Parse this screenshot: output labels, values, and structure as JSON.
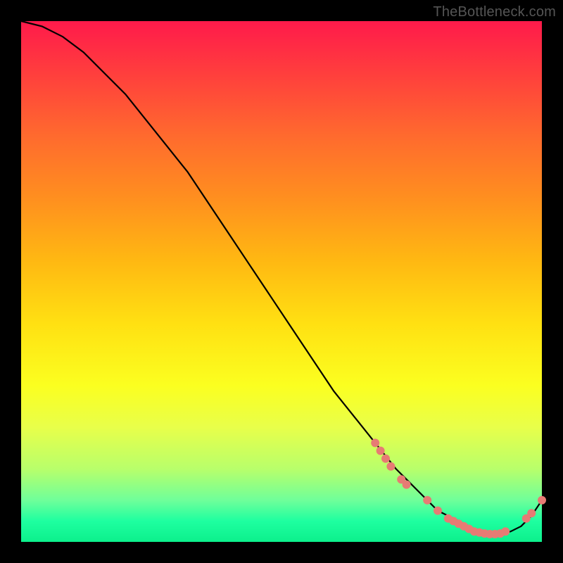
{
  "watermark": "TheBottleneck.com",
  "chart_data": {
    "type": "line",
    "title": "",
    "xlabel": "",
    "ylabel": "",
    "xlim": [
      0,
      100
    ],
    "ylim": [
      0,
      100
    ],
    "grid": false,
    "legend": false,
    "series": [
      {
        "name": "curve",
        "color": "#000000",
        "x": [
          0,
          4,
          8,
          12,
          16,
          20,
          24,
          28,
          32,
          36,
          40,
          44,
          48,
          52,
          56,
          60,
          64,
          68,
          72,
          74,
          76,
          78,
          80,
          82,
          84,
          86,
          88,
          90,
          92,
          94,
          96,
          98,
          100
        ],
        "y": [
          100,
          99,
          97,
          94,
          90,
          86,
          81,
          76,
          71,
          65,
          59,
          53,
          47,
          41,
          35,
          29,
          24,
          19,
          14,
          12,
          10,
          8,
          6,
          5,
          4,
          3,
          2,
          1.5,
          1.5,
          2,
          3,
          5,
          8
        ]
      }
    ],
    "markers": [
      {
        "name": "highlight-dots",
        "color": "#e77b74",
        "radius_px": 6,
        "points": [
          {
            "x": 68,
            "y": 19
          },
          {
            "x": 69,
            "y": 17.5
          },
          {
            "x": 70,
            "y": 16
          },
          {
            "x": 71,
            "y": 14.5
          },
          {
            "x": 73,
            "y": 12
          },
          {
            "x": 74,
            "y": 11
          },
          {
            "x": 78,
            "y": 8
          },
          {
            "x": 80,
            "y": 6
          },
          {
            "x": 82,
            "y": 4.5
          },
          {
            "x": 83,
            "y": 4
          },
          {
            "x": 84,
            "y": 3.5
          },
          {
            "x": 85,
            "y": 3
          },
          {
            "x": 86,
            "y": 2.5
          },
          {
            "x": 87,
            "y": 2
          },
          {
            "x": 88,
            "y": 1.8
          },
          {
            "x": 89,
            "y": 1.6
          },
          {
            "x": 90,
            "y": 1.5
          },
          {
            "x": 91,
            "y": 1.5
          },
          {
            "x": 92,
            "y": 1.6
          },
          {
            "x": 93,
            "y": 2
          },
          {
            "x": 97,
            "y": 4.5
          },
          {
            "x": 98,
            "y": 5.5
          },
          {
            "x": 100,
            "y": 8
          }
        ]
      }
    ]
  }
}
